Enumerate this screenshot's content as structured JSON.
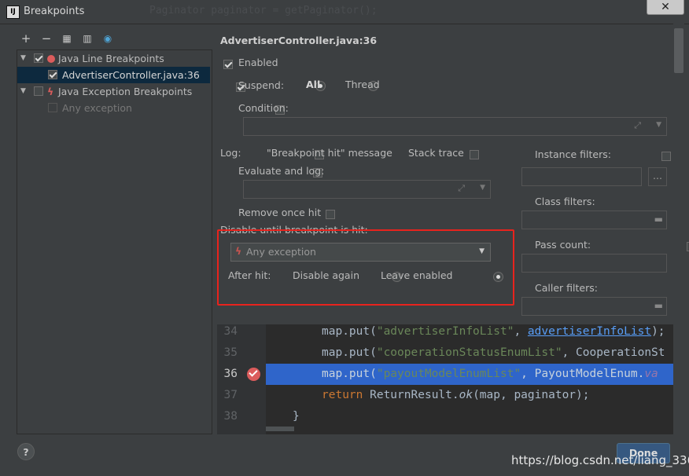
{
  "window": {
    "title": "Breakpoints",
    "background_code_hint": "Paginator paginator = getPaginator();"
  },
  "toolbar": {
    "add": "+",
    "remove": "−",
    "group1": "▦",
    "group2": "▥",
    "group3": "◉"
  },
  "tree": {
    "java_line": "Java Line Breakpoints",
    "advertiser": "AdvertiserController.java:36",
    "java_exception": "Java Exception Breakpoints",
    "any_exception": "Any exception"
  },
  "details": {
    "header": "AdvertiserController.java:36",
    "enabled": "Enabled",
    "suspend": "Suspend:",
    "all": "All",
    "thread": "Thread",
    "condition": "Condition:",
    "log": "Log:",
    "breakpoint_hit": "\"Breakpoint hit\" message",
    "stack_trace": "Stack trace",
    "evaluate_log": "Evaluate and log:",
    "remove_once": "Remove once hit",
    "disable_until": "Disable until breakpoint is hit:",
    "any_exception": "Any exception",
    "after_hit": "After hit:",
    "disable_again": "Disable again",
    "leave_enabled": "Leave enabled",
    "instance_filters": "Instance filters:",
    "class_filters": "Class filters:",
    "pass_count": "Pass count:",
    "caller_filters": "Caller filters:",
    "browse": "..."
  },
  "code": {
    "lines": [
      {
        "num": "34",
        "pre": "map.put(",
        "str": "\"advertiserInfoList\"",
        "mid": ", ",
        "ref": "advertiserInfoList",
        "post": ");"
      },
      {
        "num": "35",
        "pre": "map.put(",
        "str": "\"cooperationStatusEnumList\"",
        "mid": ", ",
        "ref": "CooperationSt",
        "post": ""
      },
      {
        "num": "36",
        "pre": "map.put(",
        "str": "\"payoutModelEnumList\"",
        "mid": ", ",
        "ref": "PayoutModelEnum.",
        "post": "va"
      },
      {
        "num": "37",
        "kw": "return",
        "pre": " ReturnResult.",
        "it": "ok",
        "post": "(map, paginator);"
      },
      {
        "num": "38",
        "pre": "}",
        "str": "",
        "mid": "",
        "ref": "",
        "post": ""
      }
    ]
  },
  "footer": {
    "help": "?",
    "done": "Done",
    "watermark": "https://blog.csdn.net/liang_336"
  },
  "colors": {
    "selection": "#2f65ca",
    "highlight_box": "#e8231d",
    "breakpoint": "#db5c5c"
  }
}
